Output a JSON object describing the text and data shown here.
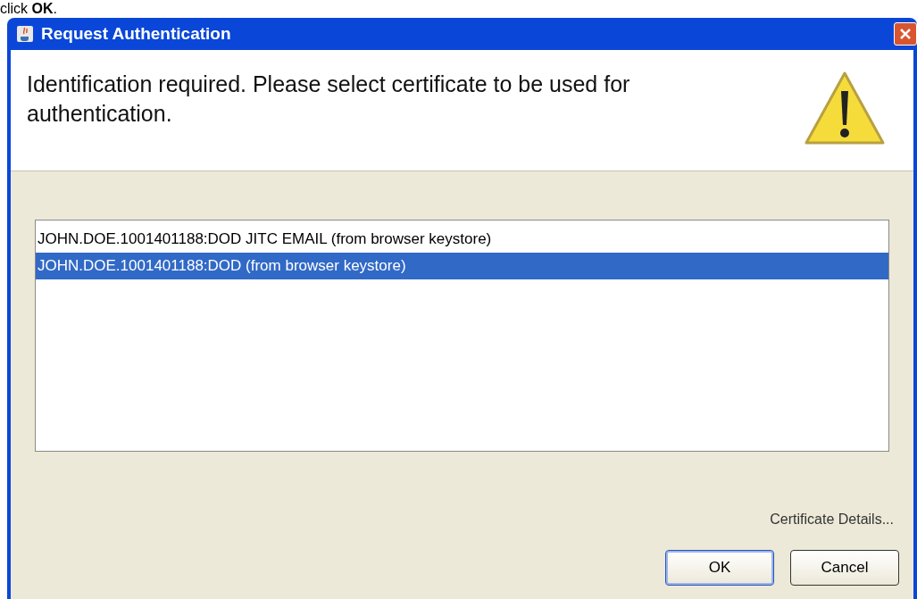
{
  "caption": "click **OK**.",
  "window": {
    "title": "Request Authentication"
  },
  "message": "Identification required.  Please select certificate to be used for authentication.",
  "certificates": [
    {
      "label": "JOHN.DOE.1001401188:DOD JITC EMAIL (from browser keystore)",
      "selected": false
    },
    {
      "label": "JOHN.DOE.1001401188:DOD (from browser keystore)",
      "selected": true
    }
  ],
  "details_link": "Certificate Details...",
  "buttons": [
    {
      "label": "OK",
      "default": true
    },
    {
      "label": "Cancel",
      "default": false
    }
  ]
}
